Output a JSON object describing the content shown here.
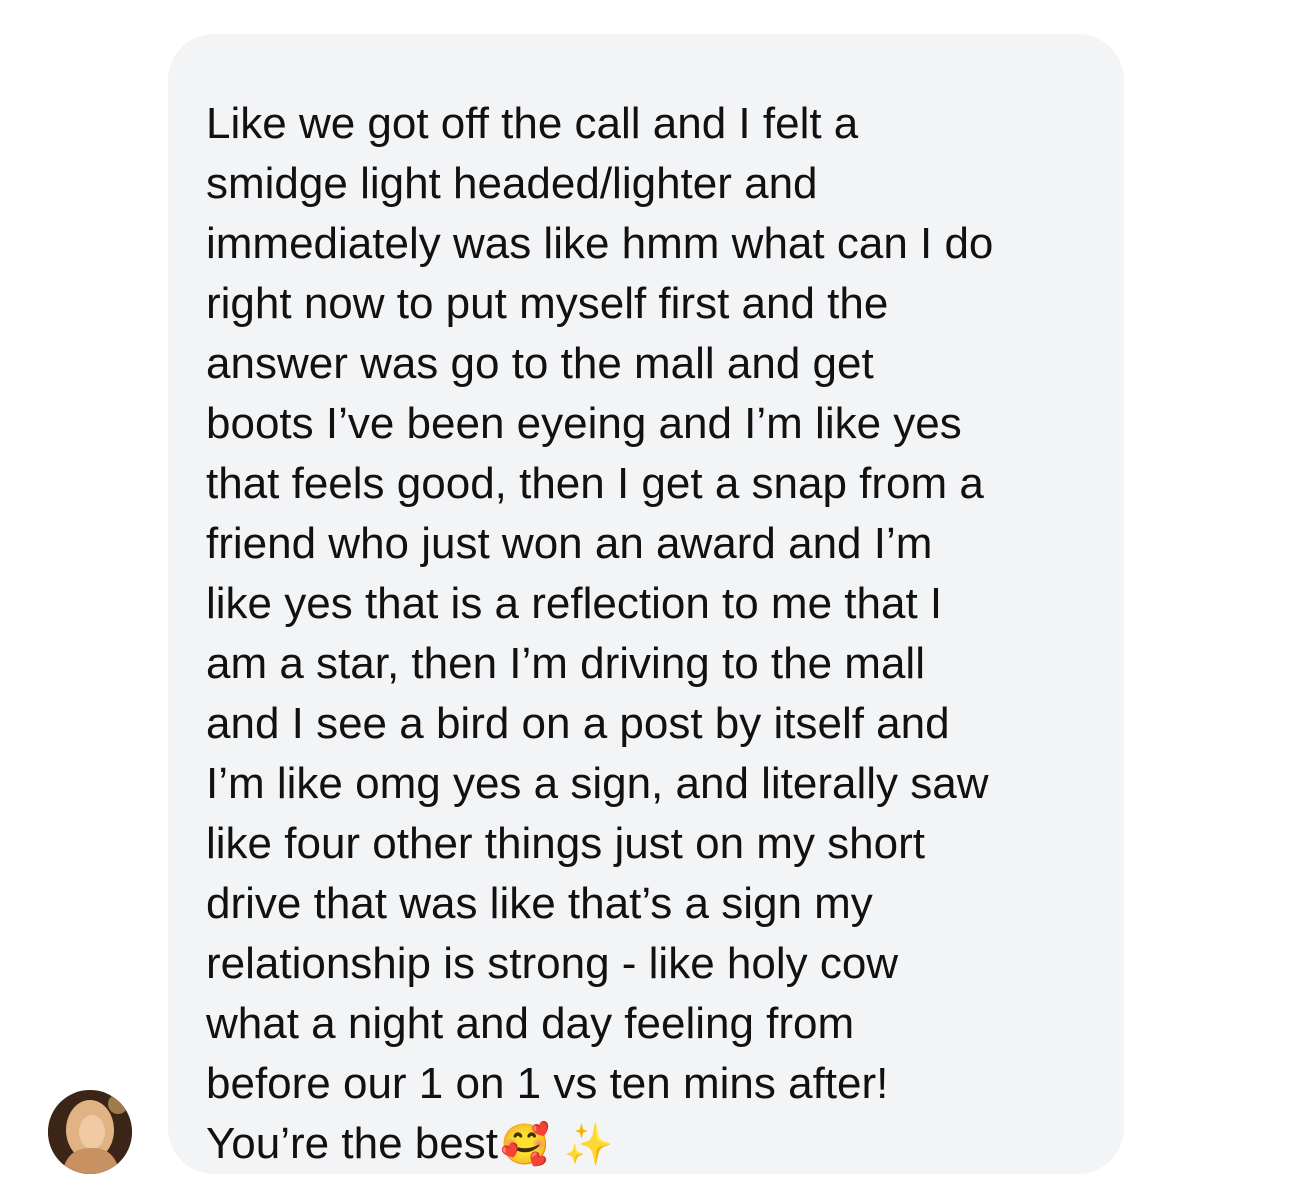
{
  "message": {
    "lines": [
      "Like we got off the call and I felt a",
      "smidge light headed/lighter and",
      "immediately was like hmm what can I do",
      "right now to put myself first and the",
      "answer was go to the mall and get",
      "boots I’ve been eyeing and I’m like yes",
      "that feels good, then I get a snap from a",
      "friend who just won an award and I’m",
      "like yes that is a reflection to me that I",
      "am a star, then I’m driving to the mall",
      "and I see a bird on a post by itself and",
      "I’m like omg yes a sign, and literally saw",
      "like four other things just on my short",
      "drive that was like that’s a sign my",
      "relationship is strong - like holy cow",
      "what a night and day feeling from",
      "before our 1 on 1 vs ten mins after!",
      "You’re the best"
    ],
    "emoji_smiling": "🥰",
    "emoji_sparkles": "✨"
  },
  "icons": {
    "avatar": "sender-avatar",
    "emoji_1": "smiling-face-with-hearts-icon",
    "emoji_2": "sparkles-icon"
  },
  "colors": {
    "bubble": "#f3f4f6",
    "text": "#111111"
  }
}
